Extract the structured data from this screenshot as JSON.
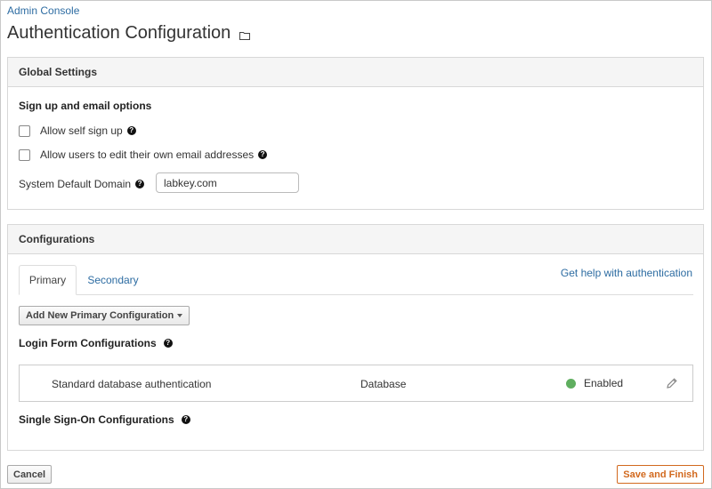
{
  "breadcrumb": "Admin Console",
  "page_title": "Authentication Configuration",
  "global": {
    "header": "Global Settings",
    "section_title": "Sign up and email options",
    "allow_self_signup": "Allow self sign up",
    "allow_edit_email": "Allow users to edit their own email addresses",
    "domain_label": "System Default Domain",
    "domain_value": "labkey.com"
  },
  "configs": {
    "header": "Configurations",
    "tabs": [
      {
        "label": "Primary"
      },
      {
        "label": "Secondary"
      }
    ],
    "help_link": "Get help with authentication",
    "add_button": "Add New Primary Configuration",
    "login_form_title": "Login Form Configurations",
    "items": [
      {
        "name": "Standard database authentication",
        "type": "Database",
        "status": "Enabled"
      }
    ],
    "sso_title": "Single Sign-On Configurations"
  },
  "footer": {
    "cancel": "Cancel",
    "save": "Save and Finish"
  },
  "colors": {
    "link": "#2d6ca2",
    "enabled": "#5fae5f",
    "save_accent": "#d2691e"
  },
  "icons": {
    "folder": "folder-icon",
    "help": "question-circle-icon",
    "edit": "pencil-icon"
  }
}
